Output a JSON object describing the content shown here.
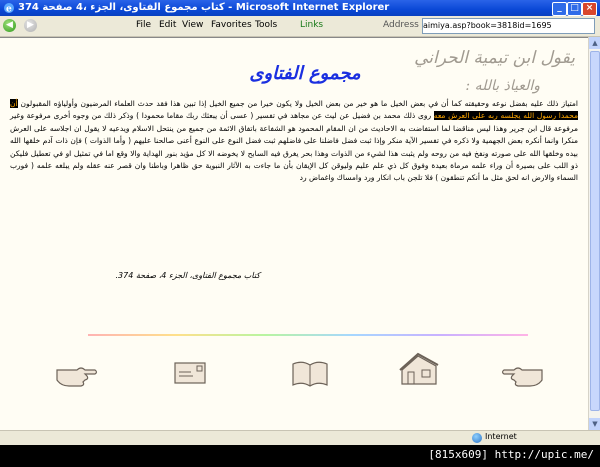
{
  "window": {
    "title": "374 كتاب مجموع الفتاوى، الجزء ،4 صفحة - Microsoft Internet Explorer",
    "min_label": "_",
    "max_label": "□",
    "close_label": "×"
  },
  "menubar": {
    "back_icon": "back-arrow-icon",
    "forward_icon": "forward-arrow-icon",
    "items": [
      "File",
      "Edit",
      "View",
      "Favorites",
      "Tools"
    ],
    "links_label": "Links",
    "address_label": "Address",
    "address_value": "aimiya.asp?book=3818id=1695"
  },
  "page": {
    "quote_line1": "يقول ابن تيمية الحراني",
    "quote_line2": "والعياذ بالله :",
    "heading": "مجموع الفتاوى",
    "text_before_highlight": "امتياز ذلك عليه بفضل نوعه وحقيقته كما أن في بعض الخيل ما هو خير من بعض الخيل ولا يكون خيرا من جميع الخيل إذا تبين هذا فقد حدث العلماء المرضيون وأولياؤه المقبولون",
    "highlight": "أن محمدا رسول الله يجلسه ربه على العرش معه",
    "text_after_highlight": "روى ذلك محمد بن فضيل عن ليث عن مجاهد في تفسير ( عسى أن يبعثك ربك مقاما محمودا ) وذكر ذلك من وجوه أخرى مرفوعة وغير مرفوعة قال ابن جرير وهذا ليس مناقضا لما استفاضت به الاحاديث من ان المقام المحمود هو الشفاعة باتفاق الائمة من جميع من ينتحل الاسلام ويدعيه لا يقول ان اجلاسه على العرش منكرا وانما أنكره بعض الجهمية ولا ذكره في تفسير الآية منكر وإذا ثبت فضل فاضلنا على فاضلهم ثبت فضل النوع على النوع أعنى صالحنا عليهم ( وأما الذوات ) فإن ذات آدم خلقها الله بيده وخلقها الله على صورته ونفخ فيه من روحه ولم يثبت هذا لشيء من الذوات وهذا بحر يغرق فيه السابح لا يخوضه الا كل مؤيد بنور الهداية والا وقع اما في تمثيل او في تعطيل فليكن ذو اللب على بصيرة أن وراء علمه مرماة بعيدة وفوق كل ذي علم عليم وليوقن كل الإيقان بأن ما جاءت به الآثار النبوية حق ظاهرا وباطنا وان قصر عنه عقله ولم يبلغه علمه ( فورب السماء والارض انه لحق مثل ما أنكم تنطقون ) فلا تلجن باب انكار ورد وامساك واغماض رد",
    "citation": "كتاب مجموع الفتاوى، الجزء 4، صفحة 374."
  },
  "footer_icons": [
    "pointing-hand-right-icon",
    "envelope-icon",
    "open-book-icon",
    "house-icon",
    "pointing-hand-left-icon"
  ],
  "status": {
    "zone": "Internet"
  },
  "watermark": "[815x609] http://upic.me/"
}
